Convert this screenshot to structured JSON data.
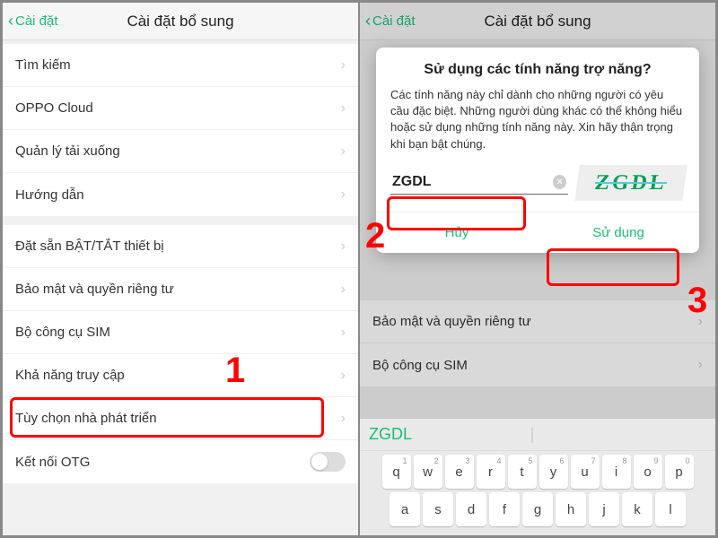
{
  "header": {
    "back": "Cài đặt",
    "title": "Cài đặt bổ sung"
  },
  "left": {
    "groups": [
      {
        "items": [
          {
            "label": "Tìm kiếm",
            "chev": true
          },
          {
            "label": "OPPO Cloud",
            "chev": true
          },
          {
            "label": "Quản lý tải xuống",
            "chev": true
          },
          {
            "label": "Hướng dẫn",
            "chev": true
          }
        ]
      },
      {
        "items": [
          {
            "label": "Đặt sẵn BẬT/TẮT thiết bị",
            "chev": true
          },
          {
            "label": "Bảo mật và quyền riêng tư",
            "chev": true
          },
          {
            "label": "Bộ công cụ SIM",
            "chev": true
          },
          {
            "label": "Khả năng truy cập",
            "chev": true
          },
          {
            "label": "Tùy chọn nhà phát triển",
            "chev": true
          },
          {
            "label": "Kết nối OTG",
            "toggle": true
          }
        ]
      }
    ]
  },
  "right": {
    "visible_items": [
      {
        "label": "Bảo mật và quyền riêng tư"
      },
      {
        "label": "Bộ công cụ SIM"
      }
    ]
  },
  "dialog": {
    "title": "Sử dụng các tính năng trợ năng?",
    "message": "Các tính năng này chỉ dành cho những người có yêu cầu đặc biệt. Những người dùng khác có thể không hiểu hoặc sử dụng những tính năng này. Xin hãy thận trọng khi bạn bật chúng.",
    "input_value": "ZGDL",
    "captcha_text": "ZGDL",
    "cancel": "Hủy",
    "confirm": "Sử dụng"
  },
  "keyboard": {
    "suggestion": "ZGDL",
    "row1": [
      {
        "k": "q",
        "n": "1"
      },
      {
        "k": "w",
        "n": "2"
      },
      {
        "k": "e",
        "n": "3"
      },
      {
        "k": "r",
        "n": "4"
      },
      {
        "k": "t",
        "n": "5"
      },
      {
        "k": "y",
        "n": "6"
      },
      {
        "k": "u",
        "n": "7"
      },
      {
        "k": "i",
        "n": "8"
      },
      {
        "k": "o",
        "n": "9"
      },
      {
        "k": "p",
        "n": "0"
      }
    ],
    "row2": [
      {
        "k": "a"
      },
      {
        "k": "s"
      },
      {
        "k": "d"
      },
      {
        "k": "f"
      },
      {
        "k": "g"
      },
      {
        "k": "h"
      },
      {
        "k": "j"
      },
      {
        "k": "k"
      },
      {
        "k": "l"
      }
    ]
  },
  "annotations": {
    "n1": "1",
    "n2": "2",
    "n3": "3"
  }
}
